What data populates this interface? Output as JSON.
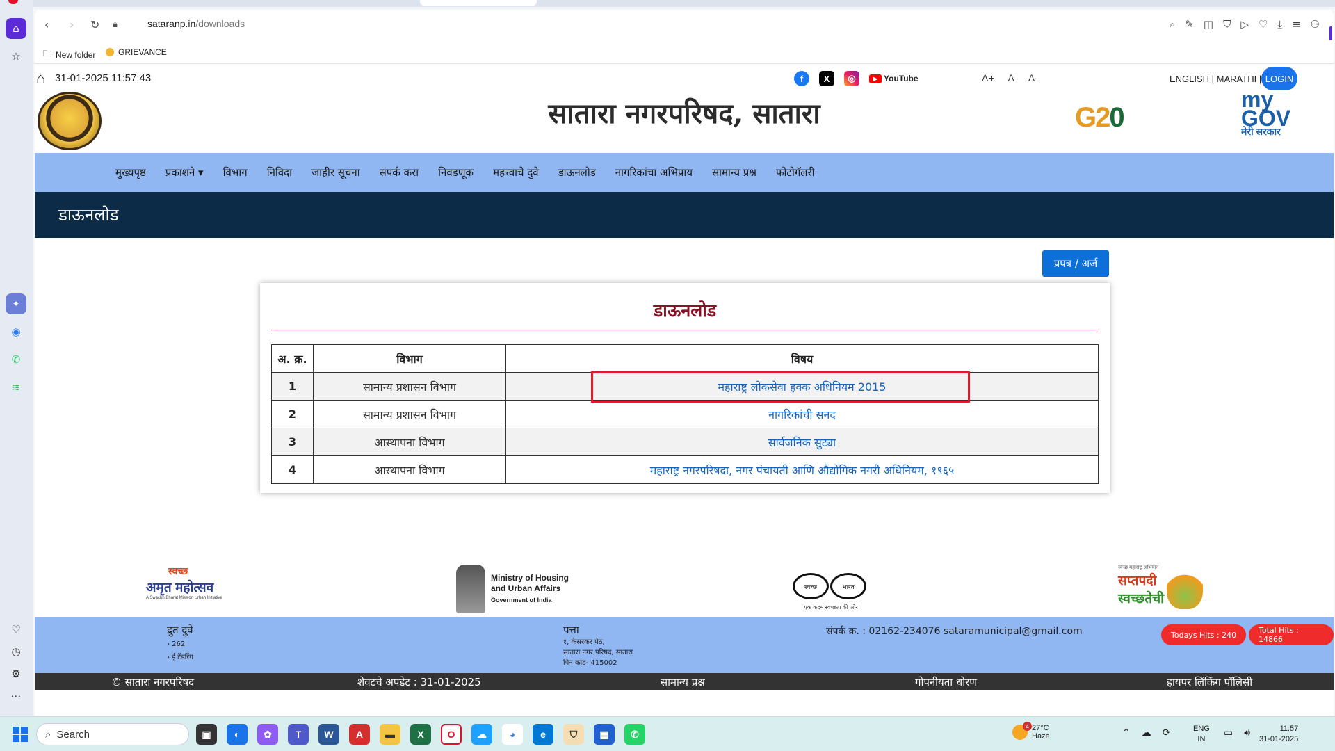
{
  "browser": {
    "url_domain": "sataranp.in",
    "url_path": "/downloads",
    "bookmarks": [
      "New folder",
      "GRIEVANCE"
    ]
  },
  "header": {
    "datetime": "31-01-2025 11:57:43",
    "title": "सातारा नगरपरिषद, सातारा",
    "youtube_label": "YouTube",
    "font_controls": [
      "A+",
      "A",
      "A-"
    ],
    "languages": "ENGLISH | MARATHI |",
    "login": "LOGIN",
    "g20_text": "G20",
    "mygov_text": [
      "my",
      "GOV",
      "मेरी सरकार"
    ]
  },
  "nav": [
    "मुख्यपृष्ठ",
    "प्रकाशने ▾",
    "विभाग",
    "निविदा",
    "जाहीर सूचना",
    "संपर्क करा",
    "निवडणूक",
    "महत्त्वाचे दुवे",
    "डाऊनलोड",
    "नागरिकांचा अभिप्राय",
    "सामान्य प्रश्न",
    "फोटोगॅलरी"
  ],
  "banner_title": "डाऊनलोड",
  "form_button": "प्रपत्र / अर्ज",
  "card": {
    "title": "डाऊनलोड",
    "headers": [
      "अ. क्र.",
      "विभाग",
      "विषय"
    ],
    "rows": [
      {
        "num": "1",
        "dept": "सामान्य प्रशासन विभाग",
        "subject": "महाराष्ट्र लोकसेवा हक्क अधिनियम 2015"
      },
      {
        "num": "2",
        "dept": "सामान्य प्रशासन विभाग",
        "subject": "नागरिकांची सनद"
      },
      {
        "num": "3",
        "dept": "आस्थापना विभाग",
        "subject": "सार्वजनिक सुट्या"
      },
      {
        "num": "4",
        "dept": "आस्थापना विभाग",
        "subject": "महाराष्ट्र नगरपरिषदा, नगर पंचायती आणि औद्योगिक नगरी अधिनियम, १९६५"
      }
    ]
  },
  "partners": {
    "amrit": {
      "top": "स्वच्छ",
      "main": "अमृत महोत्सव",
      "tag": "A Swachh Bharat Mission Urban Initiative"
    },
    "mohua": {
      "line1": "Ministry of Housing",
      "line2": "and Urban Affairs",
      "line3": "Government of India"
    },
    "swachh": {
      "left": "स्वच्छ",
      "right": "भारत",
      "caption": "एक कदम स्वच्छता की ओर"
    },
    "sapta": {
      "top": "स्वच्छ महाराष्ट्र अभियान",
      "l1": "सप्तपदी",
      "l2": "स्वच्छतेची"
    }
  },
  "footer": {
    "quick_title": "द्रुत दुवे",
    "quick_items": [
      "› 262",
      "› ई टेंडरिंग"
    ],
    "address_title": "पत्ता",
    "address_lines": [
      "१, केसरकर पेठ,",
      "सातारा नगर परिषद, सातारा",
      "पिन कोड- 415002"
    ],
    "contact": "संपर्क क्र. : 02162-234076 sataramunicipal@gmail.com",
    "todays_hits": "Todays Hits : 240",
    "total_hits": "Total Hits : 14866",
    "bottom": [
      "© सातारा नगरपरिषद",
      "शेवटचे अपडेट : 31-01-2025",
      "सामान्य प्रश्न",
      "गोपनीयता धोरण",
      "हायपर लिंकिंग पॉलिसी"
    ]
  },
  "taskbar": {
    "search_placeholder": "Search",
    "weather_temp": "27°C",
    "weather_desc": "Haze",
    "weather_badge": "4",
    "lang_line1": "ENG",
    "lang_line2": "IN",
    "time": "11:57",
    "date": "31-01-2025"
  },
  "colors": {
    "nav_bg": "#90b7f2",
    "banner_bg": "#0c2b47",
    "title_red": "#8a1026",
    "link_blue": "#1565c0",
    "highlight_border": "#e01b2b"
  }
}
